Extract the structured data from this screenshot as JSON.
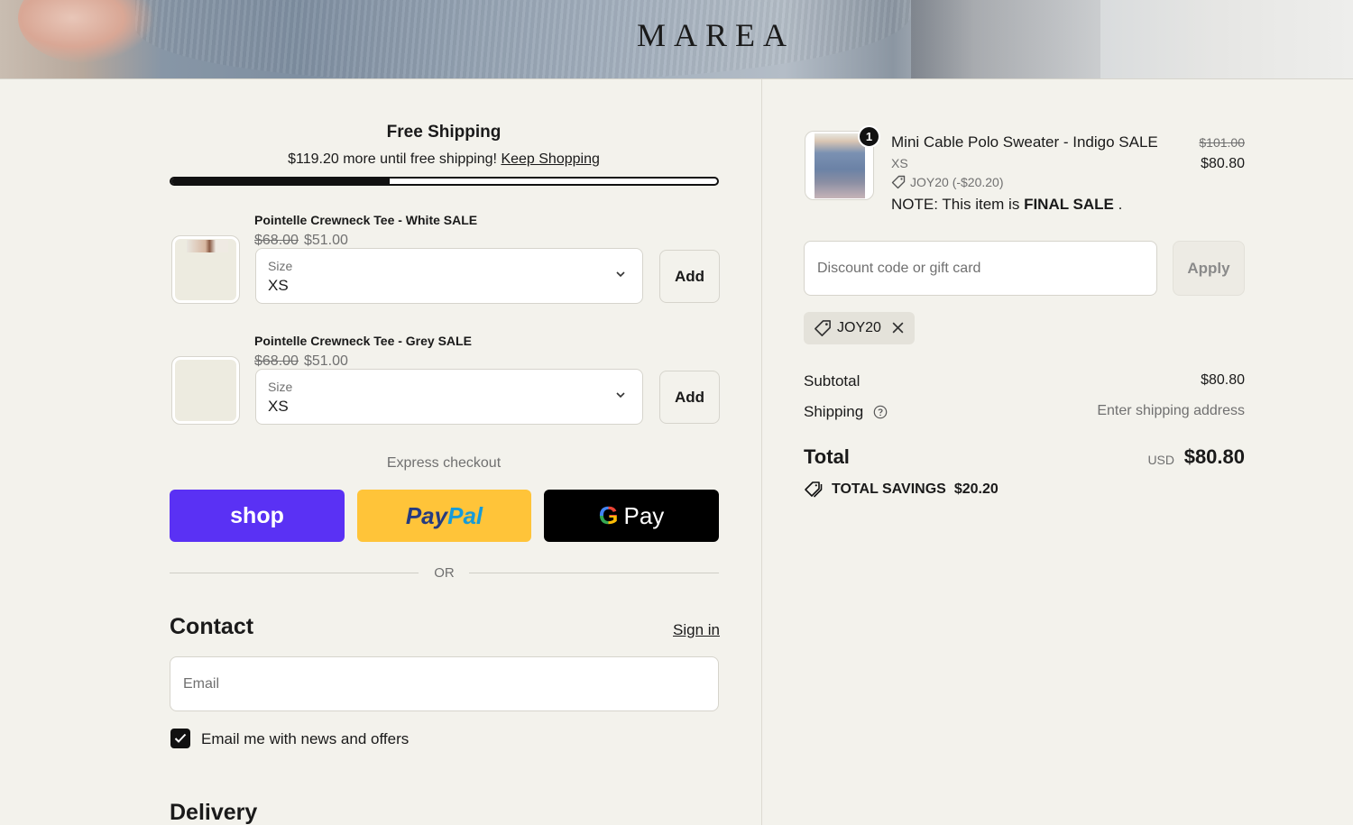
{
  "header": {
    "logo": "MAREA"
  },
  "free_shipping": {
    "title": "Free Shipping",
    "message": "$119.20 more until free shipping!",
    "link": "Keep Shopping",
    "progress_fraction": 0.4
  },
  "upsells": [
    {
      "name": "Pointelle Crewneck Tee - White SALE",
      "old_price": "$68.00",
      "price": "$51.00",
      "size_label": "Size",
      "size_value": "XS",
      "add_label": "Add"
    },
    {
      "name": "Pointelle Crewneck Tee - Grey SALE",
      "old_price": "$68.00",
      "price": "$51.00",
      "size_label": "Size",
      "size_value": "XS",
      "add_label": "Add"
    }
  ],
  "express": {
    "label": "Express checkout",
    "shop": "shop",
    "paypal_a": "Pay",
    "paypal_b": "Pal",
    "gpay_g": "G",
    "gpay_text": "Pay",
    "or": "OR"
  },
  "contact": {
    "title": "Contact",
    "sign_in": "Sign in",
    "email_placeholder": "Email",
    "newsletter": "Email me with news and offers",
    "newsletter_checked": true
  },
  "delivery": {
    "title": "Delivery"
  },
  "cart": {
    "quantity": "1",
    "name": "Mini Cable Polo Sweater - Indigo SALE",
    "variant": "XS",
    "discount": "JOY20 (-$20.20)",
    "note_prefix": "NOTE: This item is",
    "note_bold": "FINAL SALE",
    "note_suffix": ".",
    "old_price": "$101.00",
    "price": "$80.80"
  },
  "discount_box": {
    "placeholder": "Discount code or gift card",
    "apply": "Apply",
    "code": "JOY20"
  },
  "summary": {
    "subtotal_label": "Subtotal",
    "subtotal": "$80.80",
    "shipping_label": "Shipping",
    "shipping": "Enter shipping address",
    "total_label": "Total",
    "currency": "USD",
    "total": "$80.80",
    "savings_label": "TOTAL SAVINGS",
    "savings": "$20.20"
  }
}
